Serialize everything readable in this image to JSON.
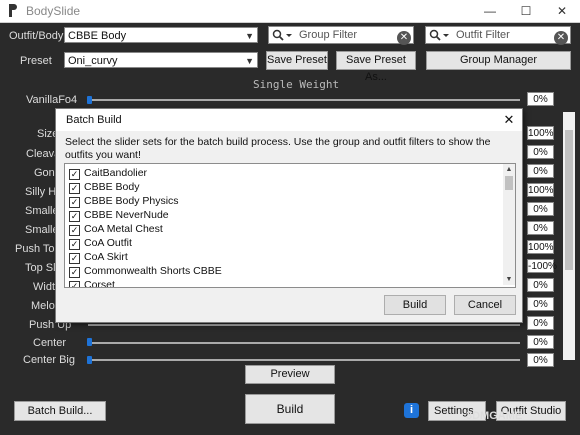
{
  "window": {
    "title": "BodySlide",
    "minimize_icon": "minimize-icon",
    "maximize_icon": "maximize-icon",
    "close_icon": "close-icon"
  },
  "outfit_body": {
    "label": "Outfit/Body",
    "value": "CBBE Body"
  },
  "group_filter": {
    "placeholder": "Group Filter"
  },
  "outfit_filter": {
    "placeholder": "Outfit Filter"
  },
  "preset": {
    "label": "Preset",
    "value": "Oni_curvy",
    "save_label": "Save Preset",
    "save_as_label": "Save Preset As...",
    "group_manager_label": "Group Manager"
  },
  "section_title": "Single Weight",
  "sliders": [
    {
      "label": "VanillaFo4",
      "value": "0%"
    },
    {
      "label": "Size",
      "value": "100%"
    },
    {
      "label": "Cleavage",
      "value": "0%"
    },
    {
      "label": "Gone",
      "value": "0%"
    },
    {
      "label": "Silly Huge",
      "value": "100%"
    },
    {
      "label": "Smaller",
      "value": "0%"
    },
    {
      "label": "Smaller",
      "value": "0%"
    },
    {
      "label": "Push Together",
      "value": "100%"
    },
    {
      "label": "Top Slope",
      "value": "-100%"
    },
    {
      "label": "Width",
      "value": "0%"
    },
    {
      "label": "Melons",
      "value": "0%"
    },
    {
      "label": "Push Up",
      "value": "0%"
    },
    {
      "label": "Center",
      "value": "0%"
    },
    {
      "label": "Center Big",
      "value": "0%"
    }
  ],
  "footer": {
    "preview_label": "Preview",
    "build_label": "Build",
    "batch_build_label": "Batch Build...",
    "settings_label": "Settings",
    "outfit_studio_label": "Outfit Studio",
    "info_icon": "info-icon"
  },
  "dialog": {
    "title": "Batch Build",
    "description": "Select the slider sets for the batch build process. Use the group and outfit filters to show the outfits you want!",
    "items": [
      {
        "label": "CaitBandolier",
        "checked": true
      },
      {
        "label": "CBBE Body",
        "checked": true
      },
      {
        "label": "CBBE Body Physics",
        "checked": true
      },
      {
        "label": "CBBE NeverNude",
        "checked": true
      },
      {
        "label": "CoA Metal Chest",
        "checked": true
      },
      {
        "label": "CoA Outfit",
        "checked": true
      },
      {
        "label": "CoA Skirt",
        "checked": true
      },
      {
        "label": "Commonwealth Shorts CBBE",
        "checked": true
      },
      {
        "label": "Corset",
        "checked": true
      }
    ],
    "build_label": "Build",
    "cancel_label": "Cancel"
  },
  "watermark": "3DMGAME"
}
